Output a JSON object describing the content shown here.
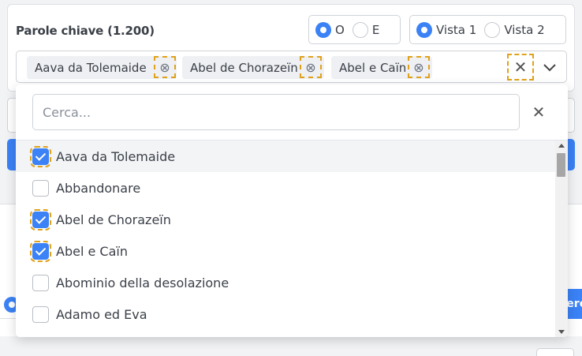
{
  "filter": {
    "title": "Parole chiave (1.200)",
    "operator_options": [
      {
        "label": "O",
        "selected": true
      },
      {
        "label": "E",
        "selected": false
      }
    ],
    "view_options": [
      {
        "label": "Vista 1",
        "selected": true
      },
      {
        "label": "Vista 2",
        "selected": false
      }
    ],
    "selected_chips": [
      "Aava da Tolemaide",
      "Abel de Chorazeïn",
      "Abel e Caïn"
    ]
  },
  "dropdown": {
    "search_placeholder": "Cerca...",
    "search_value": "",
    "items": [
      {
        "label": "Aava da Tolemaide",
        "checked": true,
        "highlighted": true
      },
      {
        "label": "Abbandonare",
        "checked": false
      },
      {
        "label": "Abel de Chorazeïn",
        "checked": true
      },
      {
        "label": "Abel e Caïn",
        "checked": true
      },
      {
        "label": "Abominio della desolazione",
        "checked": false
      },
      {
        "label": "Adamo ed Eva",
        "checked": false
      }
    ]
  },
  "background": {
    "button_label": "cerca"
  },
  "colors": {
    "accent": "#3b82f6",
    "highlight_outline": "#e0a21b"
  },
  "icons": {
    "chip_remove": "circle-x-icon",
    "clear_all": "close-icon",
    "expand": "chevron-down-icon"
  }
}
